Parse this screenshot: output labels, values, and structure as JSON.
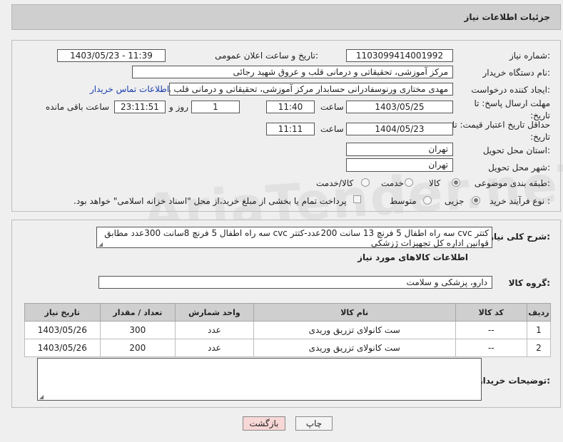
{
  "header": {
    "title": "جزئیات اطلاعات نیاز"
  },
  "fields": {
    "need_number_label": "شماره نیاز:",
    "need_number": "1103099414001992",
    "announce_label": "تاریخ و ساعت اعلان عمومی:",
    "announce_value": "1403/05/23 - 11:39",
    "buyer_org_label": "نام دستگاه خریدار:",
    "buyer_org": "مرکز آموزشی، تحقیقاتی و درمانی قلب و عروق شهید رجائی",
    "requester_label": "ایجاد کننده درخواست:",
    "requester": "مهدی مختاری ورنوسفادرانی حسابدار مرکز آموزشی، تحقیقاتی و درمانی قلب و",
    "contact_link": "اطلاعات تماس خریدار",
    "deadline_label": "مهلت ارسال پاسخ: تا تاریخ:",
    "deadline_date": "1403/05/25",
    "time_word": "ساعت",
    "deadline_time": "11:40",
    "days_value": "1",
    "days_word": "روز و",
    "remaining_time": "23:11:51",
    "remaining_label": "ساعت باقی مانده",
    "price_valid_label": "حداقل تاریخ اعتبار قیمت: تا تاریخ:",
    "price_valid_date": "1404/05/23",
    "price_valid_time": "11:11",
    "province_label": "استان محل تحویل:",
    "province": "تهران",
    "city_label": "شهر محل تحویل:",
    "city": "تهران",
    "category_label": "طبقه بندی موضوعی:",
    "cat_goods": "کالا",
    "cat_service": "خدمت",
    "cat_goods_service": "کالا/خدمت",
    "process_label": "نوع فرآیند خرید :",
    "proc_minor": "جزیی",
    "proc_medium": "متوسط",
    "payment_note": "پرداخت تمام یا بخشی از مبلغ خرید،از محل \"اسناد خزانه اسلامی\" خواهد بود."
  },
  "description": {
    "label": "شرح کلی نیاز:",
    "text": "کتتر cvc سه راه اطفال 5 فرنچ 13 سانت 200عدد-کتتر cvc سه راه اطفال 5 فرنچ 8سانت 300عدد مطابق قوانین اداره کل تجهیزات ژزشکی"
  },
  "goods_info": {
    "title": "اطلاعات کالاهای مورد نیاز",
    "group_label": "گروه کالا:",
    "group_value": "دارو، پزشکی و سلامت"
  },
  "table": {
    "headers": [
      "ردیف",
      "کد کالا",
      "نام کالا",
      "واحد شمارش",
      "تعداد / مقدار",
      "تاریخ نیاز"
    ],
    "rows": [
      [
        "1",
        "--",
        "ست کانولای تزریق وریدی",
        "عدد",
        "300",
        "1403/05/26"
      ],
      [
        "2",
        "--",
        "ست کانولای تزریق وریدی",
        "عدد",
        "200",
        "1403/05/26"
      ]
    ]
  },
  "buyer_notes": {
    "label": "توضیحات خریدار:"
  },
  "buttons": {
    "print": "چاپ",
    "back": "بازگشت"
  },
  "watermark": "AriaTender.neT",
  "colors": {
    "link": "#1a3fb0",
    "back_button_bg": "#f8d7d7",
    "header_bg": "#cfcfcf"
  }
}
